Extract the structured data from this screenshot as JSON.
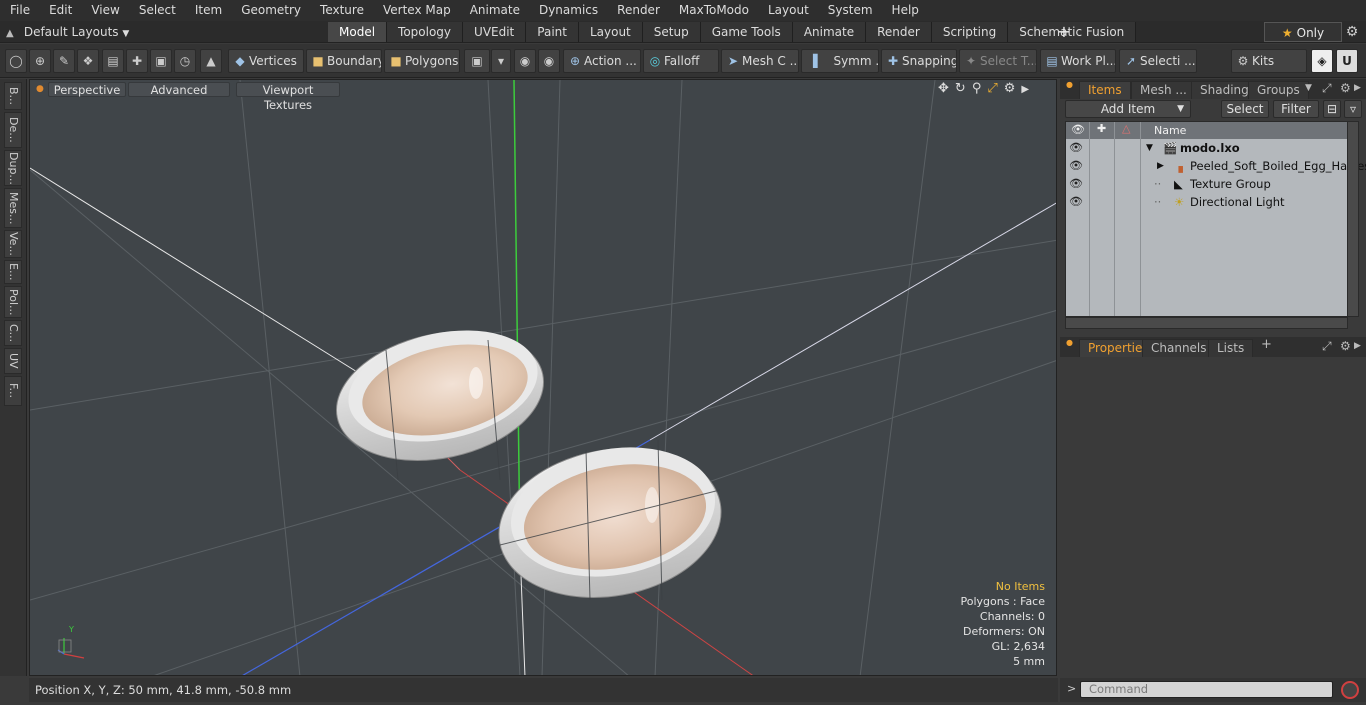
{
  "menu": [
    "File",
    "Edit",
    "View",
    "Select",
    "Item",
    "Geometry",
    "Texture",
    "Vertex Map",
    "Animate",
    "Dynamics",
    "Render",
    "MaxToModo",
    "Layout",
    "System",
    "Help"
  ],
  "layout_dropdown": "Default Layouts",
  "layout_tabs": [
    "Model",
    "Topology",
    "UVEdit",
    "Paint",
    "Layout",
    "Setup",
    "Game Tools",
    "Animate",
    "Render",
    "Scripting",
    "Schematic Fusion"
  ],
  "active_layout_tab": "Model",
  "only_label": "Only",
  "toolbar": {
    "vertices": "Vertices",
    "boundary": "Boundary",
    "polygons": "Polygons",
    "action": "Action",
    "falloff": "Falloff",
    "mesh_c": "Mesh C ...",
    "symm": "Symm ...",
    "snapping": "Snapping",
    "select_t": "Select T...",
    "work_pl": "Work Pl...",
    "selecti": "Selecti ...",
    "kits": "Kits"
  },
  "left_tabs": [
    "B...",
    "De...",
    "Dup...",
    "Mes...",
    "Ve...",
    "E...",
    "Pol...",
    "C...",
    "UV",
    "F..."
  ],
  "viewport": {
    "perspective": "Perspective",
    "advanced": "Advanced",
    "viewport_textures": "Viewport Textures",
    "info": {
      "no_items": "No Items",
      "polygons": "Polygons : Face",
      "channels": "Channels: 0",
      "deformers": "Deformers: ON",
      "gl": "GL: 2,634",
      "scale": "5 mm"
    },
    "axis_y": "Y"
  },
  "status": {
    "position": "Position X, Y, Z:  50 mm, 41.8 mm, -50.8 mm"
  },
  "items_panel": {
    "tabs": [
      "Items",
      "Mesh ...",
      "Shading",
      "Groups"
    ],
    "active_tab": "Items",
    "add_item": "Add Item",
    "select": "Select",
    "filter": "Filter",
    "column_name": "Name",
    "tree": [
      {
        "name": "modo.lxo"
      },
      {
        "name": "Peeled_Soft_Boiled_Egg_Halves"
      },
      {
        "name": "Texture Group"
      },
      {
        "name": "Directional Light"
      }
    ]
  },
  "properties_panel": {
    "tabs": [
      "Properties",
      "Channels",
      "Lists"
    ],
    "active_tab": "Properties"
  },
  "command": {
    "placeholder": "Command"
  }
}
